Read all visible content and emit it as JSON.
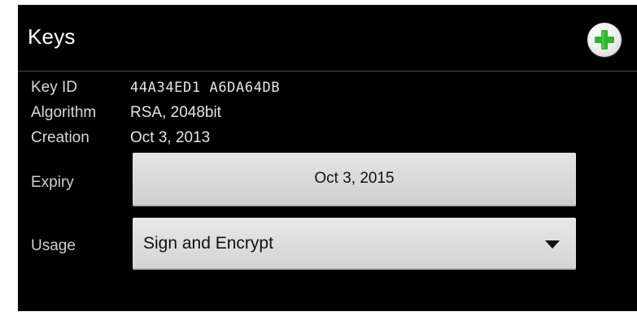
{
  "header": {
    "title": "Keys",
    "add_icon": "plus-icon",
    "accent_color": "#2bb52b"
  },
  "key_info": {
    "key_id_label": "Key ID",
    "key_id_value": "44A34ED1 A6DA64DB",
    "algorithm_label": "Algorithm",
    "algorithm_value": "RSA, 2048bit",
    "creation_label": "Creation",
    "creation_value": "Oct 3, 2013"
  },
  "expiry": {
    "label": "Expiry",
    "value": "Oct 3, 2015"
  },
  "usage": {
    "label": "Usage",
    "selected": "Sign and Encrypt",
    "dropdown_icon": "triangle-down-icon"
  }
}
